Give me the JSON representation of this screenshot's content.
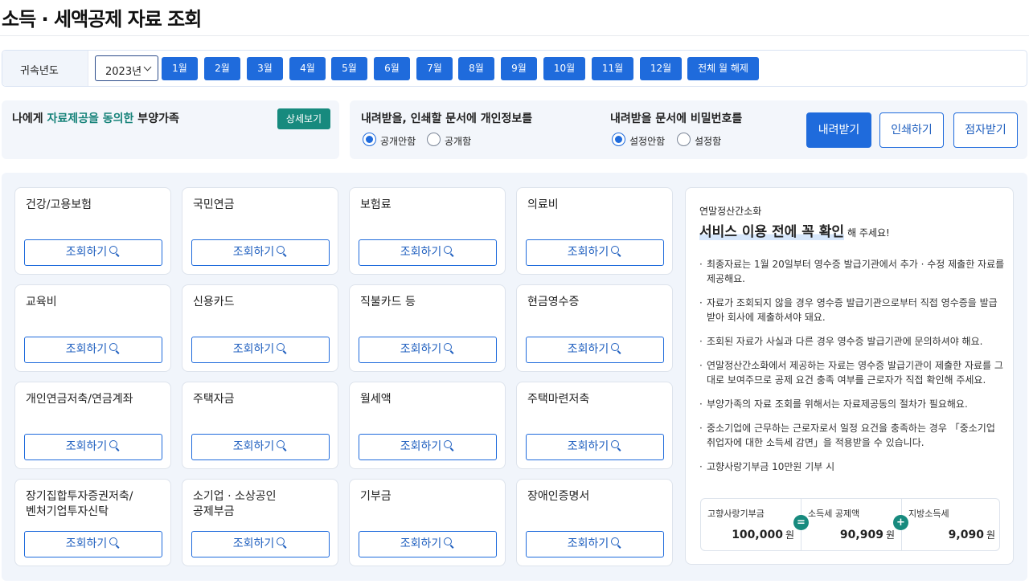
{
  "page": {
    "title": "소득 · 세액공제 자료 조회"
  },
  "filter": {
    "label": "귀속년도",
    "year": "2023년",
    "months": [
      "1월",
      "2월",
      "3월",
      "4월",
      "5월",
      "6월",
      "7월",
      "8월",
      "9월",
      "10월",
      "11월",
      "12월"
    ],
    "clear_all": "전체 월 해제"
  },
  "consent": {
    "prefix": "나에게 ",
    "highlight": "자료제공을 동의한",
    "suffix": " 부양가족",
    "detail_button": "상세보기"
  },
  "privacy": {
    "title": "내려받을, 인쇄할 문서에 개인정보를",
    "options": [
      "공개안함",
      "공개함"
    ],
    "selected": "공개안함"
  },
  "password": {
    "title": "내려받을 문서에 비밀번호를",
    "options": [
      "설정안함",
      "설정함"
    ],
    "selected": "설정안함"
  },
  "actions": {
    "download": "내려받기",
    "print": "인쇄하기",
    "braille": "점자받기"
  },
  "query_label": "조회하기",
  "cards": [
    {
      "title": "건강/고용보험"
    },
    {
      "title": "국민연금"
    },
    {
      "title": "보험료"
    },
    {
      "title": "의료비"
    },
    {
      "title": "교육비"
    },
    {
      "title": "신용카드"
    },
    {
      "title": "직불카드 등"
    },
    {
      "title": "현금영수증"
    },
    {
      "title": "개인연금저축/연금계좌"
    },
    {
      "title": "주택자금"
    },
    {
      "title": "월세액"
    },
    {
      "title": "주택마련저축"
    },
    {
      "title": "장기집합투자증권저축/\n벤처기업투자신탁"
    },
    {
      "title": "소기업 · 소상공인\n공제부금"
    },
    {
      "title": "기부금"
    },
    {
      "title": "장애인증명서"
    }
  ],
  "notice": {
    "subtitle": "연말정산간소화",
    "headline_strong": "서비스 이용 전에 꼭 확인",
    "headline_rest": "해 주세요!",
    "bullets": [
      "최종자료는 1월 20일부터 영수증 발급기관에서 추가 · 수정 제출한 자료를 제공해요.",
      "자료가 조회되지 않을 경우 영수증 발급기관으로부터 직접 영수증을 발급받아 회사에 제출하셔야 돼요.",
      "조회된 자료가 사실과 다른 경우 영수증 발급기관에 문의하셔야 해요.",
      "연말정산간소화에서 제공하는 자료는 영수증 발급기관이 제출한 자료를 그대로 보여주므로 공제 요건 충족 여부를 근로자가 직접 확인해 주세요.",
      "부양가족의 자료 조회를 위해서는 자료제공동의 절차가 필요해요.",
      "중소기업에 근무하는 근로자로서 일정 요건을 충족하는 경우 「중소기업 취업자에 대한 소득세 감면」을 적용받을 수 있습니다.",
      "고향사랑기부금 10만원 기부 시"
    ],
    "donation": {
      "items": [
        {
          "label": "고향사랑기부금",
          "value": "100,000",
          "unit": "원"
        },
        {
          "label": "소득세 공제액",
          "value": "90,909",
          "unit": "원"
        },
        {
          "label": "지방소득세",
          "value": "9,090",
          "unit": "원"
        }
      ],
      "operators": [
        "=",
        "+"
      ]
    }
  },
  "colors": {
    "primary": "#1f6bdc",
    "accent": "#178a7e",
    "panel_bg": "#f1f5fb"
  }
}
